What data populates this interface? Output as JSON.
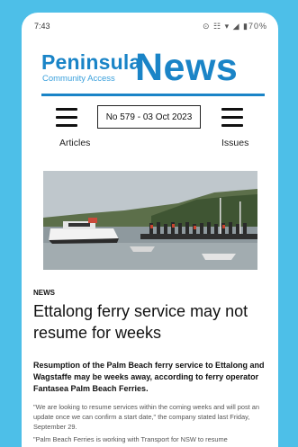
{
  "status_bar": {
    "time": "7:43",
    "icons": "⊙ ☷ ▾ ◢ ▮70%"
  },
  "logo": {
    "peninsula": "Peninsula",
    "community": "Community Access",
    "news": "News"
  },
  "nav": {
    "articles_label": "Articles",
    "issues_label": "Issues",
    "issue_number": "No 579 - 03 Oct 2023"
  },
  "article": {
    "category": "NEWS",
    "headline": "Ettalong ferry service may not resume for weeks",
    "lede": "Resumption of the Palm Beach ferry service to Ettalong and Wagstaffe may be weeks away, according to ferry operator Fantasea Palm Beach Ferries.",
    "para1": "\"We are looking to resume services within the coming weeks and will post an update once we can confirm a start date,\" the company stated last Friday, September 29.",
    "para2": "\"Palm Beach Ferries is working with Transport for NSW to resume"
  },
  "colors": {
    "background": "#4dbfe8",
    "brand_blue": "#1a84c7"
  }
}
